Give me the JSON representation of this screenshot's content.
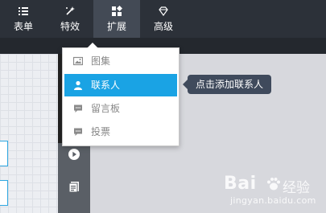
{
  "toolbar": {
    "tabs": [
      {
        "label": "表单",
        "icon": "list-icon"
      },
      {
        "label": "特效",
        "icon": "sparkle-icon"
      },
      {
        "label": "扩展",
        "icon": "grid-plus-icon",
        "active": true
      },
      {
        "label": "高级",
        "icon": "diamond-icon"
      }
    ]
  },
  "extend_menu": {
    "items": [
      {
        "label": "图集",
        "icon": "image-icon"
      },
      {
        "label": "联系人",
        "icon": "person-icon",
        "active": true
      },
      {
        "label": "留言板",
        "icon": "chat-icon"
      },
      {
        "label": "投票",
        "icon": "chat-icon"
      }
    ]
  },
  "tooltip": {
    "text": "点击添加联系人"
  },
  "side_tools": [
    {
      "icon": "play-icon"
    },
    {
      "icon": "document-icon"
    }
  ],
  "watermark": {
    "logo": "Bai",
    "brand_text": "经验",
    "url": "jingyan.baidu.com"
  },
  "colors": {
    "toolbar_bg": "#2c3139",
    "active_tab_bg": "#434a55",
    "accent": "#1aa3e4",
    "tooltip_bg": "#3f4a5c"
  }
}
